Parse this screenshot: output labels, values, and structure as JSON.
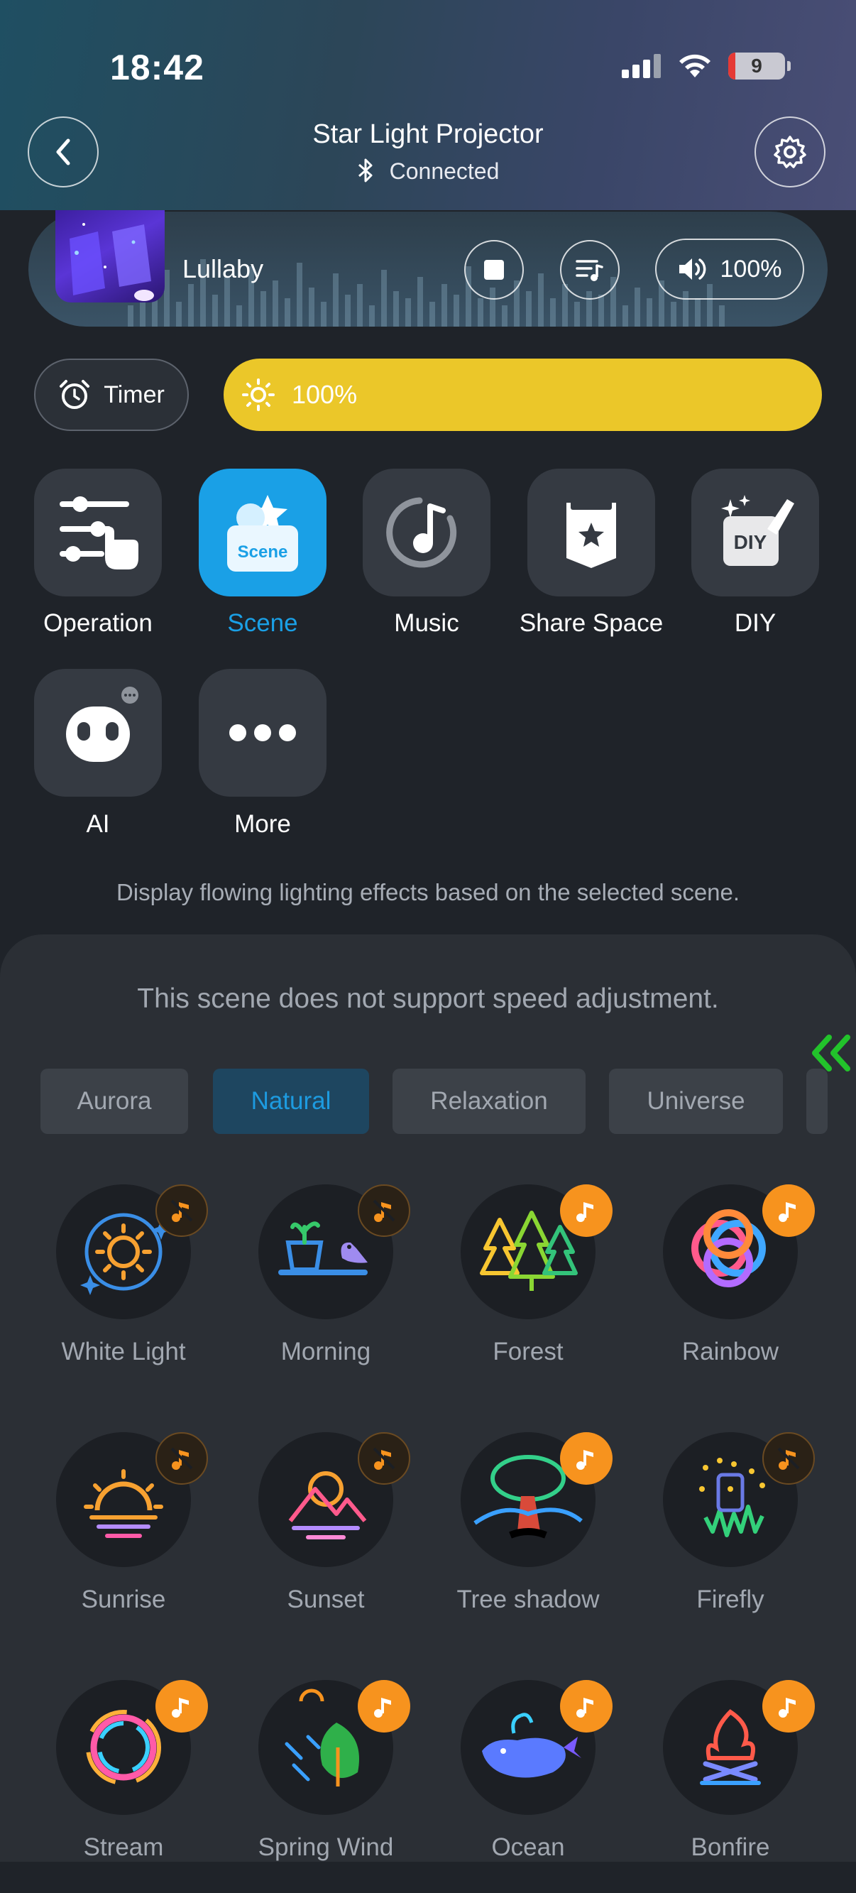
{
  "status": {
    "time": "18:42",
    "battery": "9"
  },
  "header": {
    "title": "Star Light Projector",
    "connection": "Connected"
  },
  "player": {
    "song": "Lullaby",
    "volume": "100%"
  },
  "timer": {
    "label": "Timer"
  },
  "brightness": {
    "value": "100%",
    "level": 1.0
  },
  "functions": [
    {
      "label": "Operation"
    },
    {
      "label": "Scene"
    },
    {
      "label": "Music"
    },
    {
      "label": "Share Space"
    },
    {
      "label": "DIY"
    },
    {
      "label": "AI"
    },
    {
      "label": "More"
    }
  ],
  "diy_badge": "DIY",
  "scene_badge": "Scene",
  "hint": "Display flowing lighting effects based on the selected scene.",
  "panel": {
    "speed_note": "This scene does not support speed adjustment.",
    "categories": [
      "Aurora",
      "Natural",
      "Relaxation",
      "Universe"
    ],
    "selected_category": "Natural",
    "scenes": [
      {
        "label": "White Light",
        "music": false
      },
      {
        "label": "Morning",
        "music": false
      },
      {
        "label": "Forest",
        "music": true
      },
      {
        "label": "Rainbow",
        "music": true
      },
      {
        "label": "Sunrise",
        "music": false
      },
      {
        "label": "Sunset",
        "music": false
      },
      {
        "label": "Tree shadow",
        "music": true
      },
      {
        "label": "Firefly",
        "music": false
      },
      {
        "label": "Stream",
        "music": true
      },
      {
        "label": "Spring Wind",
        "music": true
      },
      {
        "label": "Ocean",
        "music": true
      },
      {
        "label": "Bonfire",
        "music": true
      }
    ]
  },
  "colors": {
    "accent": "#1aa0e6",
    "brightness": "#ebc729",
    "music_badge": "#f7931e",
    "scroll_arrow": "#22c32b"
  }
}
